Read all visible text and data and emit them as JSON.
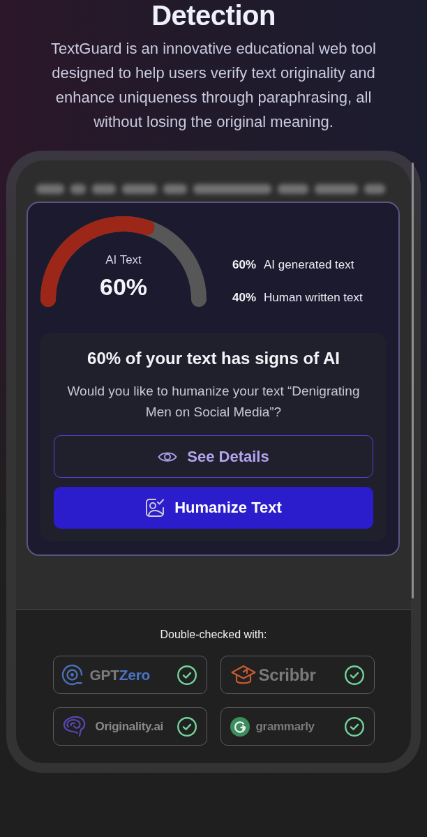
{
  "hero": {
    "title": "Detection",
    "description": "TextGuard is an innovative educational web tool designed to help users verify text originality and enhance uniqueness through paraphrasing, all without losing the original meaning."
  },
  "result": {
    "gauge": {
      "label": "AI Text",
      "value": "60%",
      "level": 0.6
    },
    "legend": [
      {
        "value": "60%",
        "label": "AI generated text"
      },
      {
        "value": "40%",
        "label": "Human written text"
      }
    ],
    "summary": {
      "title": "60% of your text has signs of AI",
      "question": "Would you like to humanize your text “Denigrating Men on Social Media”?"
    },
    "buttons": [
      {
        "kind": "outline",
        "label": "See Details"
      },
      {
        "kind": "filled",
        "label": "Humanize Text"
      }
    ]
  },
  "checkers": {
    "heading": "Double-checked with:",
    "tools": [
      {
        "kind": "spiral",
        "wordmark": [
          "GPT",
          "Zero"
        ],
        "checked": true
      },
      {
        "kind": "cap",
        "wordmark": [
          "Scribbr"
        ],
        "checked": true
      },
      {
        "kind": "brain",
        "wordmark": [
          "Originality.ai"
        ],
        "checked": true
      },
      {
        "kind": "disc",
        "wordmark": [
          "grammarly"
        ],
        "checked": true
      }
    ]
  }
}
